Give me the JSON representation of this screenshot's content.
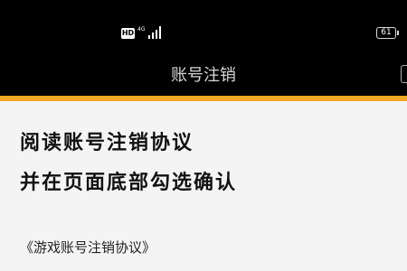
{
  "status_bar": {
    "hd_badge": "HD",
    "network": "4G",
    "battery": "61",
    "icons": [
      "hd-icon",
      "signal-icon",
      "battery-icon"
    ]
  },
  "header": {
    "title": "账号注销"
  },
  "content": {
    "heading_line1": "阅读账号注销协议",
    "heading_line2": "并在页面底部勾选确认",
    "agreement_link": "《游戏账号注销协议》"
  },
  "colors": {
    "accent": "#f5a623",
    "header_bg": "#000000",
    "content_bg": "#f4f4f4"
  }
}
